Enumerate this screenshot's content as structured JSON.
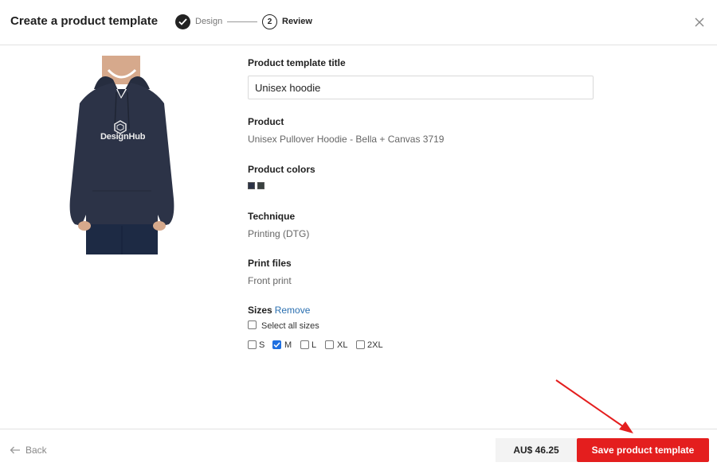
{
  "header": {
    "title": "Create a product template",
    "steps": [
      {
        "number": "1",
        "label": "Design",
        "state": "complete"
      },
      {
        "number": "2",
        "label": "Review",
        "state": "current"
      }
    ],
    "close_icon": "close-icon"
  },
  "product_image": {
    "logo_text": "DesignHub",
    "garment_color": "#2c3347"
  },
  "form": {
    "template_title": {
      "label": "Product template title",
      "value": "Unisex hoodie"
    },
    "product": {
      "label": "Product",
      "value": "Unisex Pullover Hoodie - Bella + Canvas 3719"
    },
    "colors": {
      "label": "Product colors",
      "swatches": [
        "#2c3347",
        "#3a4240"
      ]
    },
    "technique": {
      "label": "Technique",
      "value": "Printing (DTG)"
    },
    "print_files": {
      "label": "Print files",
      "value": "Front print"
    },
    "sizes": {
      "label": "Sizes",
      "remove_label": "Remove",
      "select_all_label": "Select all sizes",
      "select_all_checked": false,
      "options": [
        {
          "label": "S",
          "checked": false
        },
        {
          "label": "M",
          "checked": true
        },
        {
          "label": "L",
          "checked": false
        },
        {
          "label": "XL",
          "checked": false
        },
        {
          "label": "2XL",
          "checked": false
        }
      ]
    }
  },
  "footer": {
    "back_label": "Back",
    "price": "AU$ 46.25",
    "save_label": "Save product template"
  },
  "colors": {
    "accent": "#e41e1e",
    "link": "#2a6fb0",
    "checkbox_checked": "#1e6fe0",
    "annotation_arrow": "#e41e1e"
  }
}
